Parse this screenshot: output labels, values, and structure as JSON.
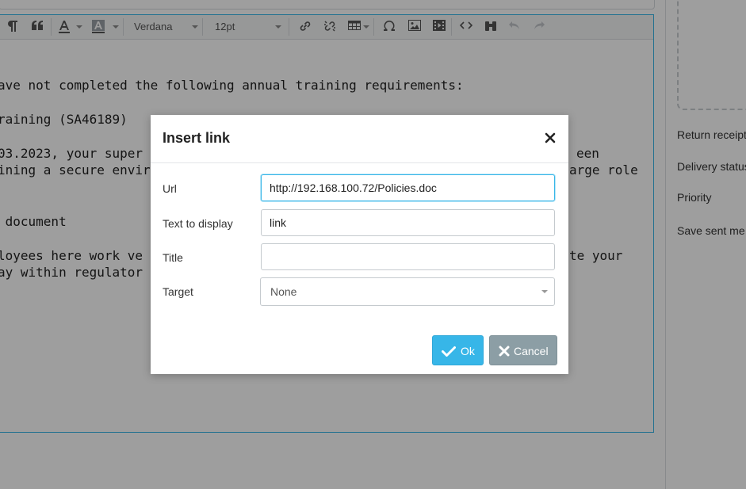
{
  "editor": {
    "toolbar": {
      "font_family": "Verdana",
      "font_size": "12pt"
    },
    "lines": [
      "ave not completed the following annual training requirements:",
      "raining (SA46189)",
      "03.2023, your super",
      "ining a secure envir",
      " document",
      "loyees here work ve",
      "ay within regulator"
    ],
    "lines_right": [
      "een",
      "arge role",
      "te your"
    ]
  },
  "side_panel": {
    "labels": [
      "Return receipt",
      "Delivery status",
      "Priority",
      "Save sent me"
    ]
  },
  "dialog": {
    "title": "Insert link",
    "fields": {
      "url": {
        "label": "Url",
        "value": "http://192.168.100.72/Policies.doc"
      },
      "text": {
        "label": "Text to display",
        "value": "link"
      },
      "title": {
        "label": "Title",
        "value": ""
      },
      "target": {
        "label": "Target",
        "value": "None"
      }
    },
    "buttons": {
      "ok": "Ok",
      "cancel": "Cancel"
    }
  },
  "colors": {
    "accent": "#37b6e8",
    "cancel": "#8c9ea5",
    "overlay": "rgba(0,0,0,0.38)"
  }
}
